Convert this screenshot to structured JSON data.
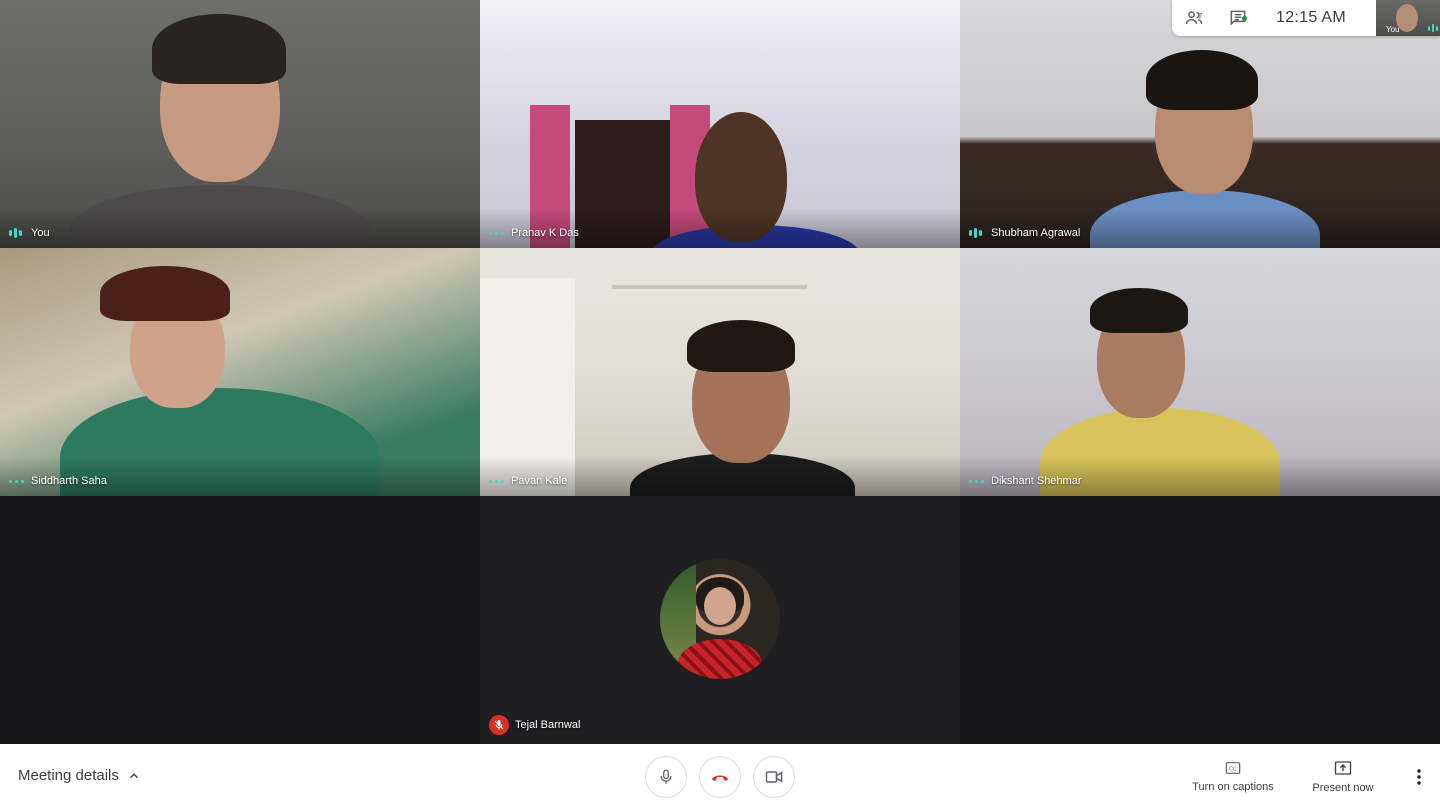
{
  "participants": [
    {
      "name": "You",
      "indicator": "speaking"
    },
    {
      "name": "Pranav K Das",
      "indicator": "active"
    },
    {
      "name": "Shubham Agrawal",
      "indicator": "speaking"
    },
    {
      "name": "Siddharth Saha",
      "indicator": "active"
    },
    {
      "name": "Pavan Kale",
      "indicator": "active"
    },
    {
      "name": "Dikshant Shehmar",
      "indicator": "active"
    },
    {
      "name": "Tejal Barnwal",
      "indicator": "muted"
    }
  ],
  "status": {
    "people_count": "7",
    "time": "12:15 AM",
    "self_label": "You",
    "icons": [
      "people-icon",
      "chat-icon"
    ]
  },
  "bottombar": {
    "meeting_details": "Meeting details",
    "captions_label": "Turn on captions",
    "present_label": "Present now",
    "controls": [
      "microphone-icon",
      "hang-up-icon",
      "camera-icon"
    ]
  },
  "colors": {
    "accent": "#41d8c8",
    "hangup": "#d93025",
    "surface": "#202124"
  }
}
